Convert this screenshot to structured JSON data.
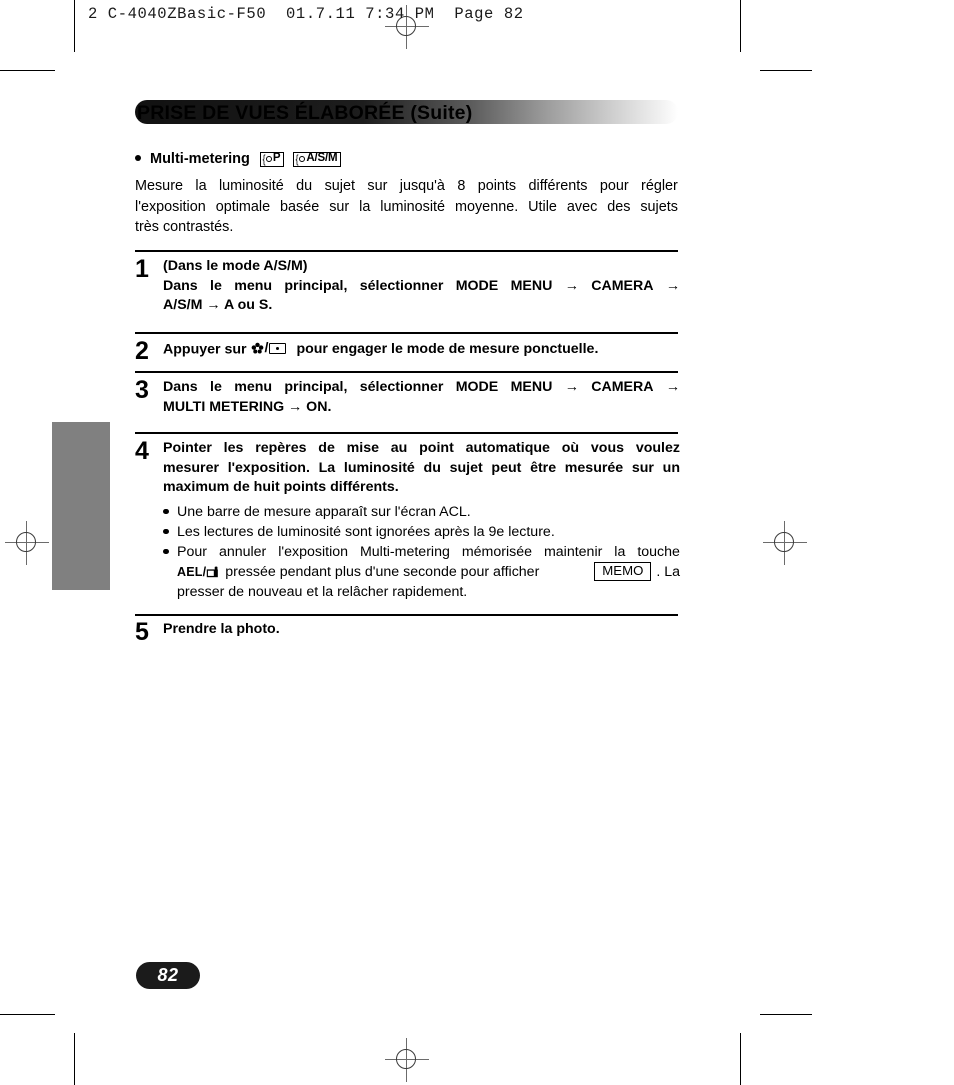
{
  "press_marks": {
    "file_header": "2 C-4040ZBasic-F50  01.7.11 7:34 PM  Page 82"
  },
  "header": {
    "title": "PRISE DE VUES ÉLABORÉE (Suite)"
  },
  "section": {
    "heading": "Multi-metering",
    "badges": [
      {
        "brace": "{",
        "label": "P"
      },
      {
        "brace": "{",
        "label": "A/S/M"
      }
    ],
    "intro_lines": [
      "Mesure la luminosité du sujet sur jusqu'à 8 points différents pour régler",
      "l'exposition optimale basée sur la luminosité moyenne. Utile avec des sujets",
      "très contrastés."
    ]
  },
  "steps": [
    {
      "num": "1",
      "lines": [
        "(Dans le mode A/S/M)",
        "Dans le menu principal, sélectionner MODE MENU → CAMERA →",
        "A/S/M → A ou S."
      ]
    },
    {
      "num": "2",
      "text_before": "Appuyer sur",
      "icon_macro": "macro-flower-icon",
      "icon_separator": "/",
      "icon_spot": "spot-metering-icon",
      "text_after": "pour engager le mode de mesure ponctuelle."
    },
    {
      "num": "3",
      "lines": [
        "Dans le menu principal, sélectionner MODE MENU → CAMERA →",
        "MULTI METERING → ON."
      ]
    },
    {
      "num": "4",
      "lines": [
        "Pointer les repères de mise au point automatique où vous voulez",
        "mesurer l'exposition. La luminosité du sujet peut être mesurée sur un",
        "maximum de huit points différents."
      ],
      "bullets": [
        "Une barre de mesure apparaît sur l'écran ACL.",
        "Les lectures de luminosité sont ignorées après la 9e lecture.",
        "Pour annuler l'exposition Multi-metering mémorisée maintenir la touche"
      ],
      "bullet3_continuation": {
        "ael_label": "AEL/",
        "ael_icon": "print-order-icon",
        "text_mid": "pressée pendant plus d'une seconde pour afficher",
        "memo_box": "MEMO",
        "text_after_box": ". La",
        "line_last": "presser de nouveau et la relâcher rapidement."
      }
    },
    {
      "num": "5",
      "lines": [
        "Prendre la photo."
      ]
    }
  ],
  "footer": {
    "page_number": "82"
  }
}
